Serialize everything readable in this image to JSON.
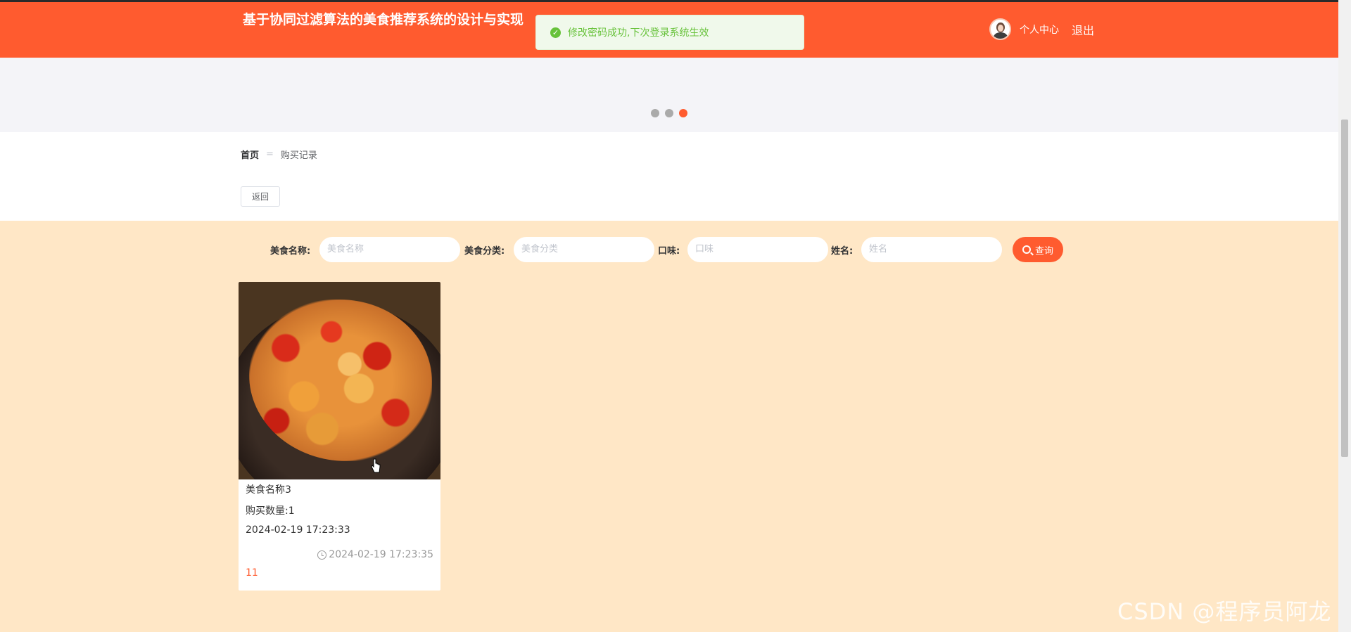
{
  "header": {
    "site_title": "基于协同过滤算法的美食推荐系统的设计与实现",
    "toast_message": "修改密码成功,下次登录系统生效",
    "user_center": "个人中心",
    "logout": "退出"
  },
  "banner": {
    "dots_count": 3,
    "active_dot": 3
  },
  "breadcrumb": {
    "home": "首页",
    "separator": "=",
    "current": "购买记录"
  },
  "back_button": "返回",
  "search": {
    "fields": [
      {
        "label": "美食名称:",
        "placeholder": "美食名称"
      },
      {
        "label": "美食分类:",
        "placeholder": "美食分类"
      },
      {
        "label": "口味:",
        "placeholder": "口味"
      },
      {
        "label": "姓名:",
        "placeholder": "姓名"
      }
    ],
    "button": "查询"
  },
  "records": [
    {
      "name": "美食名称3",
      "quantity": "购买数量:1",
      "purchase_time": "2024-02-19 17:23:33",
      "created_time": "2024-02-19 17:23:35",
      "count": "11"
    }
  ],
  "watermark": "CSDN @程序员阿龙",
  "colors": {
    "brand": "#ff5b2f",
    "page_bg": "#ffe7c6",
    "success": "#67c23a"
  }
}
